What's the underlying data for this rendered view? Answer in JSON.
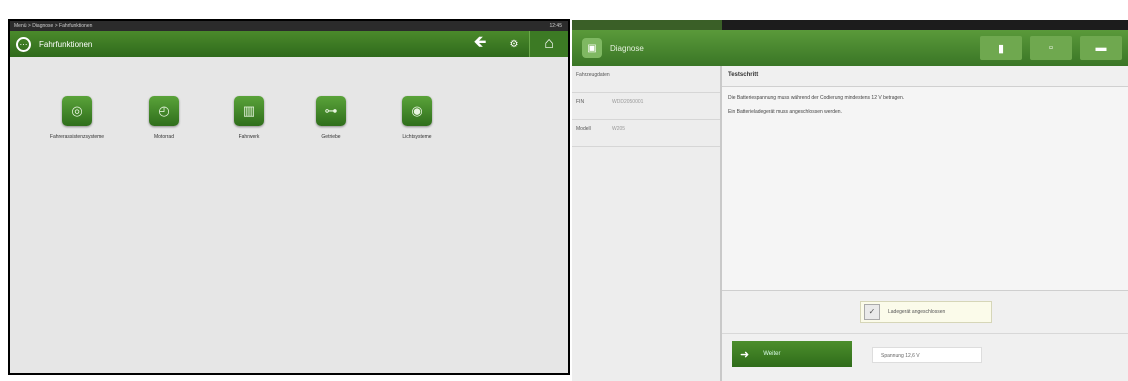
{
  "left_screen": {
    "status_text": "Menü > Diagnose > Fahrfunktionen",
    "clock": "12:45",
    "title": "Fahrfunktionen",
    "tiles": [
      {
        "label": "Fahrerassistenzsysteme",
        "icon": "steering-icon"
      },
      {
        "label": "Motorrad",
        "icon": "speedometer-icon"
      },
      {
        "label": "Fahrwerk",
        "icon": "suspension-icon"
      },
      {
        "label": "Getriebe",
        "icon": "gearbox-icon"
      },
      {
        "label": "Lichtsysteme",
        "icon": "light-icon"
      }
    ]
  },
  "right_screen": {
    "title": "Diagnose",
    "sidebar": [
      {
        "key": "Fahrzeugdaten",
        "value": ""
      },
      {
        "key": "FIN",
        "value": "WDD2050001"
      },
      {
        "key": "Modell",
        "value": "W205"
      }
    ],
    "main_header": "Testschritt",
    "main_lines": [
      "Die Batteriespannung muss während der Codierung mindestens 12 V betragen.",
      "Ein Batterieladegerät muss angeschlossen werden."
    ],
    "checkbox_label": "Ladegerät angeschlossen",
    "ok_label": "Weiter",
    "value_label": "Spannung 12,6 V"
  }
}
